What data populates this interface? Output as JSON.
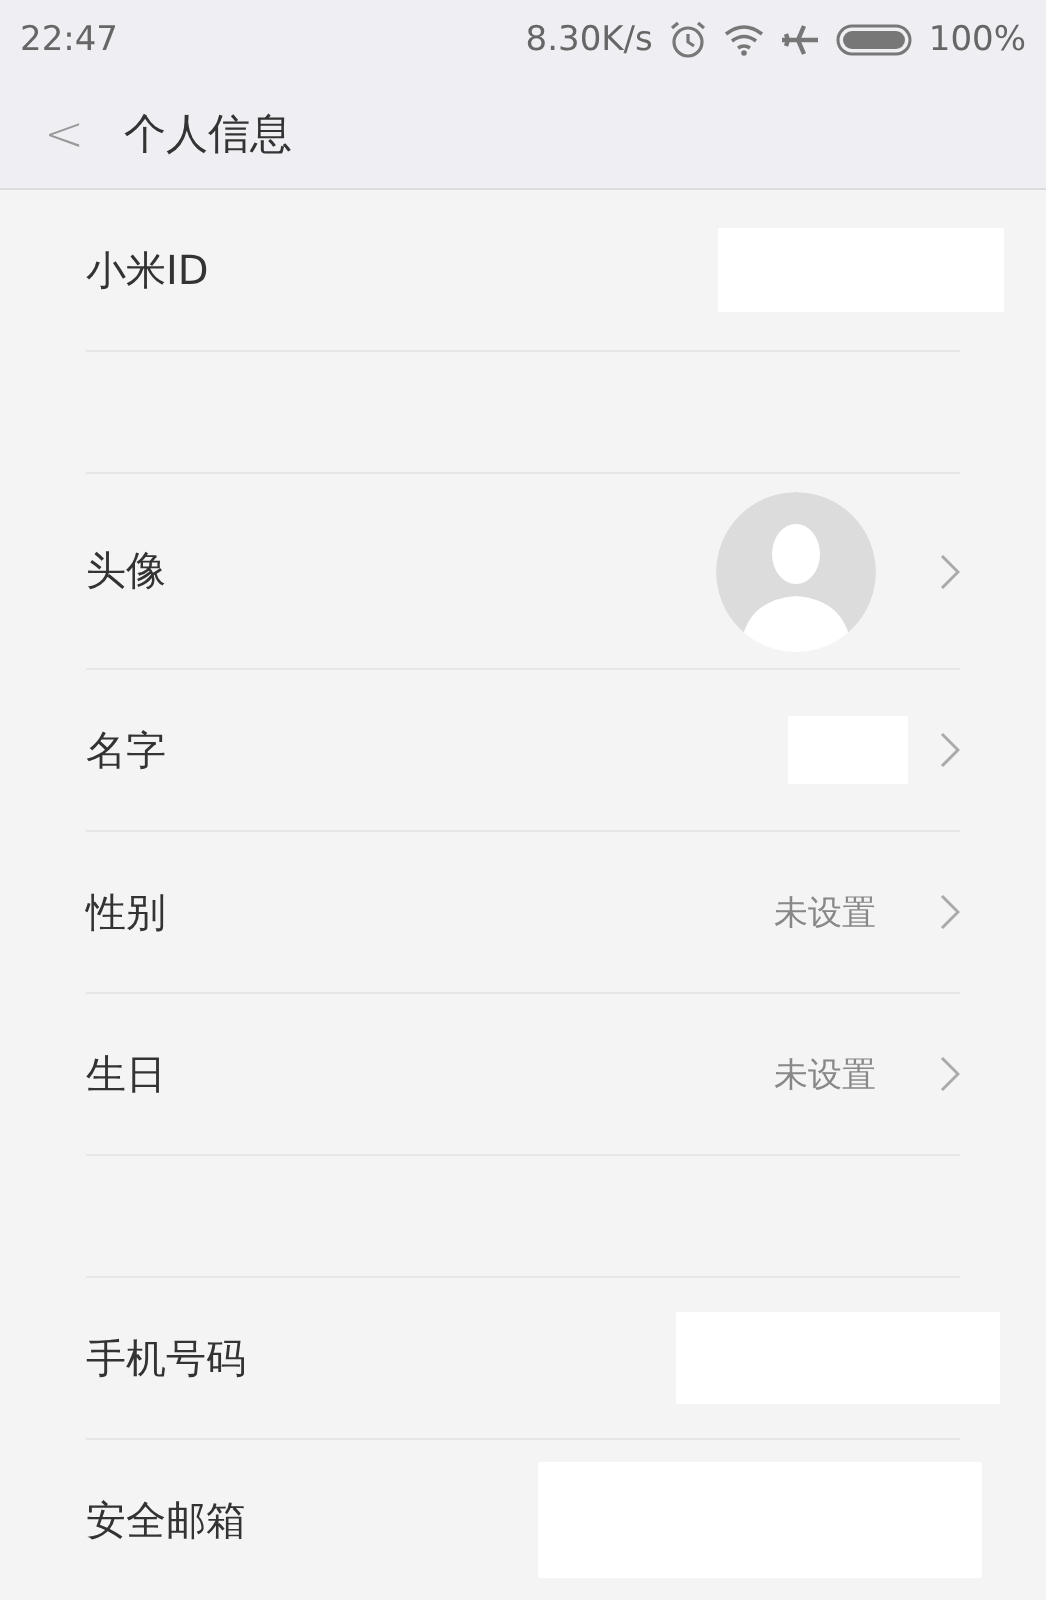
{
  "status_bar": {
    "time": "22:47",
    "speed": "8.30K/s",
    "battery": "100%"
  },
  "header": {
    "back": "<",
    "title": "个人信息"
  },
  "sections": [
    {
      "rows": [
        {
          "label": "小米ID",
          "kind": "redacted",
          "arrow": false
        }
      ]
    },
    {
      "rows": [
        {
          "label": "头像",
          "kind": "avatar",
          "arrow": true
        },
        {
          "label": "名字",
          "kind": "redacted",
          "arrow": true
        },
        {
          "label": "性别",
          "kind": "text",
          "value": "未设置",
          "arrow": true
        },
        {
          "label": "生日",
          "kind": "text",
          "value": "未设置",
          "arrow": true
        }
      ]
    },
    {
      "rows": [
        {
          "label": "手机号码",
          "kind": "redacted",
          "arrow": false
        },
        {
          "label": "安全邮箱",
          "kind": "redacted",
          "arrow": false
        }
      ]
    }
  ]
}
